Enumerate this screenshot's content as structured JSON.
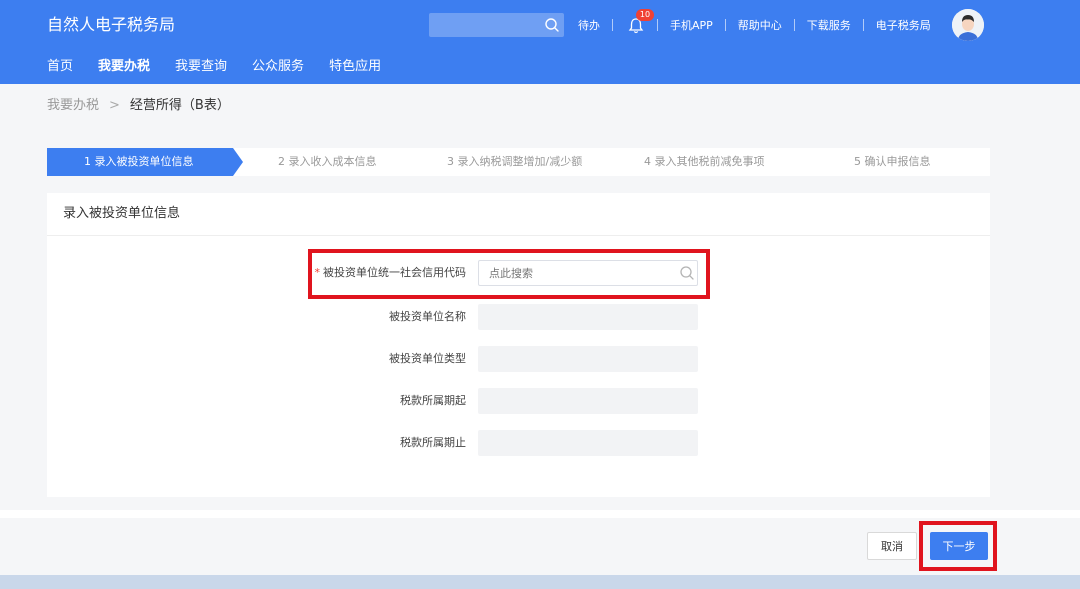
{
  "header": {
    "brand": "自然人电子税务局",
    "search_placeholder": "",
    "todo": "待办",
    "notification_count": "10",
    "links": [
      "手机APP",
      "帮助中心",
      "下载服务",
      "电子税务局"
    ],
    "accent_color": "#3d7ef0"
  },
  "mainnav": {
    "items": [
      "首页",
      "我要办税",
      "我要查询",
      "公众服务",
      "特色应用"
    ],
    "active_index": 1
  },
  "breadcrumb": {
    "parent": "我要办税",
    "separator": ">",
    "current": "经营所得（B表）"
  },
  "steps": [
    {
      "label": "1  录入被投资单位信息",
      "active": true
    },
    {
      "label": "2  录入收入成本信息",
      "active": false
    },
    {
      "label": "3  录入纳税调整增加/减少额",
      "active": false
    },
    {
      "label": "4  录入其他税前减免事项",
      "active": false
    },
    {
      "label": "5  确认申报信息",
      "active": false
    }
  ],
  "form": {
    "title": "录入被投资单位信息",
    "credit_code_label": "被投资单位统一社会信用代码",
    "credit_code_required_mark": "*",
    "credit_code_placeholder": "点此搜索",
    "fields": [
      {
        "label": "被投资单位名称",
        "value": ""
      },
      {
        "label": "被投资单位类型",
        "value": ""
      },
      {
        "label": "税款所属期起",
        "value": ""
      },
      {
        "label": "税款所属期止",
        "value": ""
      }
    ]
  },
  "actions": {
    "cancel": "取消",
    "next": "下一步"
  },
  "colors": {
    "primary": "#3d7ef0",
    "highlight": "#e0141e",
    "badge": "#f04134"
  }
}
